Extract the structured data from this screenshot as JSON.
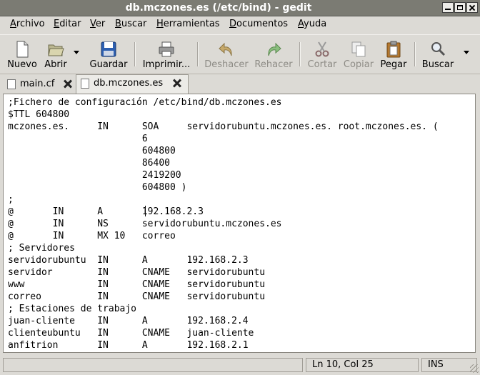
{
  "window": {
    "title": "db.mczones.es (/etc/bind) - gedit"
  },
  "menubar": {
    "items": [
      {
        "first": "A",
        "rest": "rchivo"
      },
      {
        "first": "E",
        "rest": "ditar"
      },
      {
        "first": "V",
        "rest": "er"
      },
      {
        "first": "B",
        "rest": "uscar"
      },
      {
        "first": "H",
        "rest": "erramientas"
      },
      {
        "first": "D",
        "rest": "ocumentos"
      },
      {
        "first": "A",
        "rest": "yuda"
      }
    ]
  },
  "toolbar": {
    "new": "Nuevo",
    "open": "Abrir",
    "save": "Guardar",
    "print": "Imprimir...",
    "undo": "Deshacer",
    "redo": "Rehacer",
    "cut": "Cortar",
    "copy": "Copiar",
    "paste": "Pegar",
    "find": "Buscar"
  },
  "tabs": [
    {
      "label": "main.cf"
    },
    {
      "label": "db.mczones.es"
    }
  ],
  "document": {
    "text": ";Fichero de configuración /etc/bind/db.mczones.es\n$TTL 604800\nmczones.es.     IN      SOA     servidorubuntu.mczones.es. root.mczones.es. (\n                        6\n                        604800\n                        86400\n                        2419200\n                        604800 )\n;\n@       IN      A       192.168.2.3\n@       IN      NS      servidorubuntu.mczones.es\n@       IN      MX 10   correo\n; Servidores\nservidorubuntu  IN      A       192.168.2.3\nservidor        IN      CNAME   servidorubuntu\nwww             IN      CNAME   servidorubuntu\ncorreo          IN      CNAME   servidorubuntu\n; Estaciones de trabajo\njuan-cliente    IN      A       192.168.2.4\nclienteubuntu   IN      CNAME   juan-cliente\nanfitrion       IN      A       192.168.2.1"
  },
  "status": {
    "position": "Ln 10, Col 25",
    "mode": "INS"
  }
}
